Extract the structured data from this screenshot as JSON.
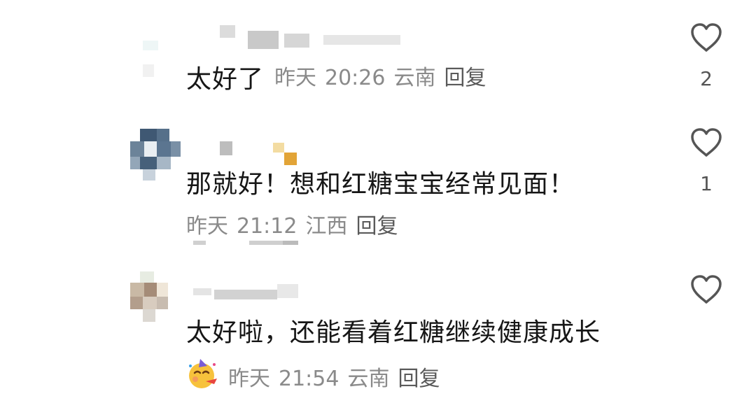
{
  "comments": [
    {
      "text": "太好了",
      "date": "昨天",
      "time": "20:26",
      "location": "云南",
      "reply": "回复",
      "likes": "2"
    },
    {
      "text": "那就好！想和红糖宝宝经常见面！",
      "date": "昨天",
      "time": "21:12",
      "location": "江西",
      "reply": "回复",
      "likes": "1"
    },
    {
      "text": "太好啦，还能看着红糖继续健康成长",
      "date": "昨天",
      "time": "21:54",
      "location": "云南",
      "reply": "回复",
      "likes": "",
      "reaction_icon": "party-face-emoji"
    }
  ],
  "colors": {
    "heart_outline": "#555555",
    "meta_text": "#8a8a8a",
    "body_text": "#161616"
  }
}
